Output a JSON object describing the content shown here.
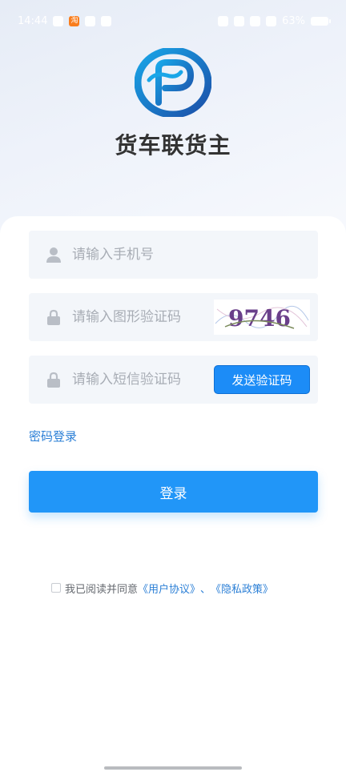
{
  "status_bar": {
    "time": "14:44",
    "battery": "63%",
    "taobao_glyph": "淘"
  },
  "app": {
    "title": "货车联货主",
    "brand_color": "#1f7fd4",
    "logo_icon": "p-swirl-logo-icon"
  },
  "form": {
    "phone": {
      "placeholder": "请输入手机号",
      "icon": "user-icon"
    },
    "image_code": {
      "placeholder": "请输入图形验证码",
      "icon": "lock-icon",
      "captcha_text": "9746"
    },
    "sms_code": {
      "placeholder": "请输入短信验证码",
      "icon": "lock-icon",
      "send_button": "发送验证码"
    },
    "password_login_link": "密码登录",
    "login_button": "登录"
  },
  "agreement": {
    "prefix": "我已阅读并同意",
    "user_agreement": "《用户协议》",
    "separator": "、",
    "privacy_policy": "《隐私政策》",
    "checked": false
  },
  "colors": {
    "primary": "#2196f8",
    "link": "#2b7fd6",
    "field_bg": "#f3f6fa",
    "placeholder": "#a8adb5"
  }
}
